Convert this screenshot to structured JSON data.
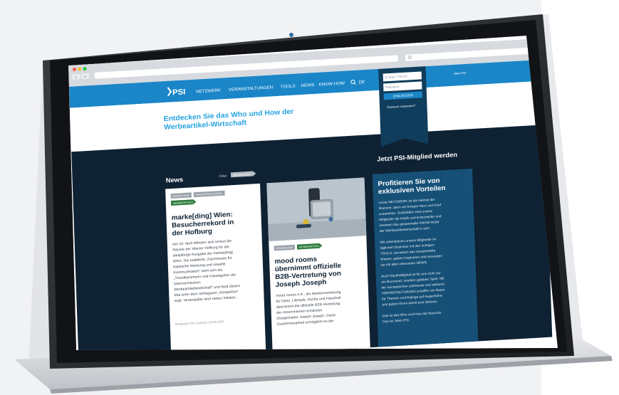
{
  "browser": {
    "url": "",
    "nav_back": "<",
    "nav_forward": ">"
  },
  "site": {
    "logo": "PSI",
    "nav": [
      "NETZWERK",
      "VERANSTALTUNGEN",
      "TOOLS",
      "NEWS",
      "KNOW-HOW"
    ],
    "lang": "DE",
    "top_right_link": "Mein PSI",
    "hero_line1": "Entdecken Sie das Who und How der",
    "hero_line2": "Werbeartikel-Wirtschaft"
  },
  "login": {
    "email_placeholder": "E-Mail / PSI-ID",
    "password_placeholder": "Passwort",
    "button": "EINLOGGEN",
    "forgot": "Passwort vergessen?"
  },
  "news": {
    "heading": "News",
    "filter_label": "Filter",
    "filter_value": "NEWSFLASH",
    "card1": {
      "tags": [
        "NEWSFLASH",
        "VERANSTALTUNGEN",
        "WERBEARTIKEL"
      ],
      "title": [
        "marke[ding] Wien:",
        "Besucherrekord in",
        "der Hofburg"
      ],
      "body": [
        "Am 18. April öffneten sich erneut die",
        "Räume der Wiener Hofburg für die",
        "diesjährige Ausgabe der marke[ding]",
        "Wien. Die etablierte „Fachmesse für",
        "haptische Werbung und visuelle",
        "Kommunikation\" sieht sich als",
        "„Trendbarometer und Impulsgeber der",
        "österreichischen",
        "Werbeartikellandschaft\" und fand dieses",
        "Mal unter dem Schlagwort „Sinnjektion\"",
        "statt. Veranstalter sind neben Initiator..."
      ],
      "footer": "Redaktion PSI Journal | 24.04.2023"
    },
    "card2": {
      "tags": [
        "NEWSFLASH",
        "WERBEARTIKEL"
      ],
      "title": [
        "mood rooms",
        "übernimmt offizielle",
        "B2B-Vertretung von",
        "Joseph Joseph"
      ],
      "body": [
        "mood rooms e.K., die Markenvertretung",
        "für Deko, Lifestyle, Küche und Haushalt",
        "übernimmt die offizielle B2B-Vertretung",
        "der renommierten britischen",
        "Designmarke Joseph Joseph. Diese",
        "Zusammenarbeit ermöglicht es der"
      ]
    }
  },
  "membership": {
    "heading": "Jetzt PSI-Mitglied werden",
    "box_title": [
      "Profitieren Sie von",
      "exklusiven Vorteilen"
    ],
    "paragraph1": [
      "Unser NETZWERK ist die Heimat der",
      "Branche, denn wir bringen Herz und Kopf",
      "zusammen. Schließlich sind unsere",
      "Mitglieder die Köpfe und Entscheider und",
      "vereinen das gesammelte KNOW-HOW",
      "der Werbeartikelwirtschaft in sich."
    ],
    "paragraph2": [
      "Wir unterstützen unsere Mitglieder im",
      "täglichen Business mit den richtigen",
      "TOOLS, vernetzen das versammelte",
      "Wissen, geben Inspiration und versorgen",
      "sie mit allen relevanten NEWS."
    ],
    "paragraph3": [
      "Auch Nachhaltigkeit ist für uns nicht nur",
      "ein Buzzword, sondern gelebter Spirit. Mit",
      "der europäischen Leitmesse und weiteren",
      "VERANSTALTUNGEN schaffen wir Raum",
      "für Themen und Dialoge auf Augenhöhe",
      "und geben Ihnen damit eine Stimme."
    ],
    "paragraph4": [
      "Das ist das Who und How der Branche.",
      "Das ist: Mein PSI."
    ]
  },
  "colors": {
    "navy": "#0e2233",
    "psi_blue": "#1a86c8",
    "light_blue_text": "#26a3e0",
    "green_tag": "#2a7a3a",
    "member_box": "#165077"
  }
}
